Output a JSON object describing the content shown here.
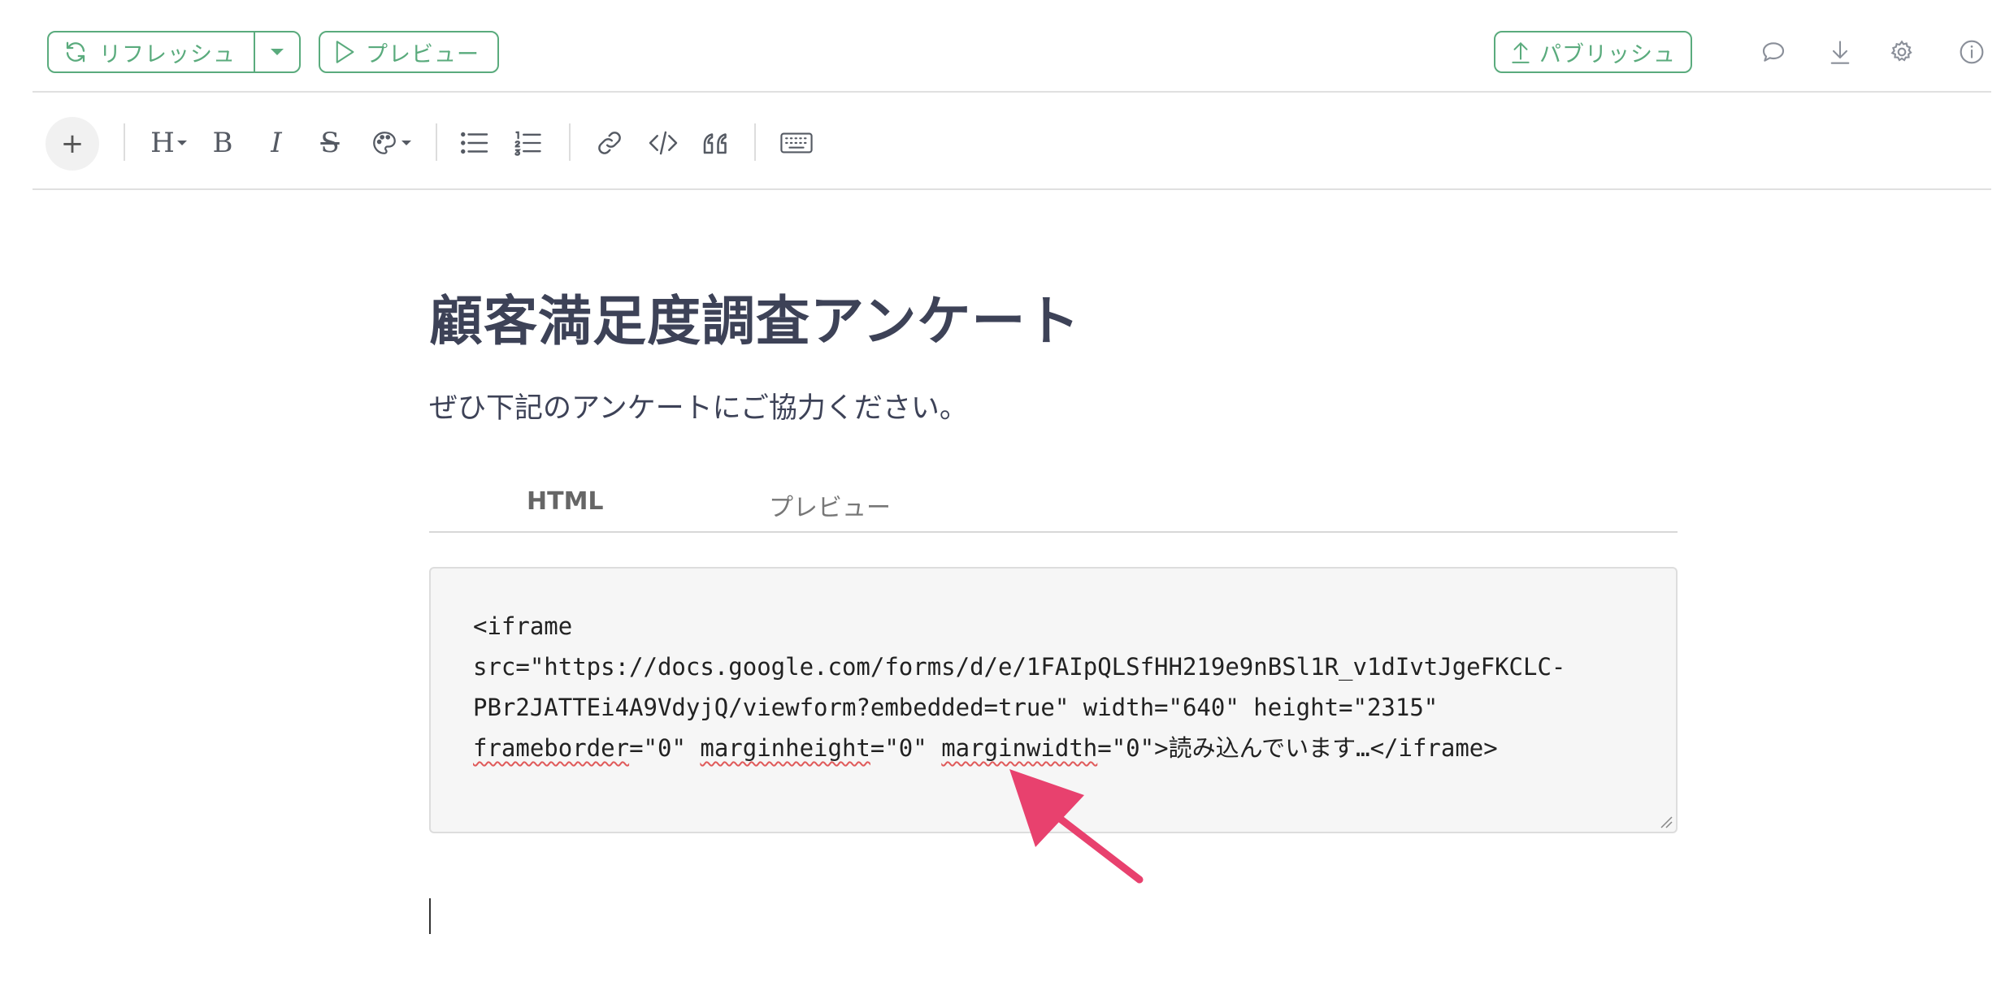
{
  "topbar": {
    "refresh_label": "リフレッシュ",
    "preview_label": "プレビュー",
    "publish_label": "パブリッシュ",
    "icons": [
      "comment-icon",
      "download-icon",
      "gear-icon",
      "info-icon"
    ]
  },
  "toolbar": {
    "insert_label": "+",
    "heading_label": "H",
    "bold_label": "B",
    "italic_label": "I",
    "strike_label": "S",
    "icons": [
      "palette-icon",
      "bullet-list-icon",
      "numbered-list-icon",
      "link-icon",
      "code-icon",
      "quote-icon",
      "keyboard-icon"
    ]
  },
  "document": {
    "title": "顧客満足度調査アンケート",
    "intro": "ぜひ下記のアンケートにご協力ください。",
    "tabs": [
      {
        "label": "HTML",
        "active": true
      },
      {
        "label": "プレビュー",
        "active": false
      }
    ],
    "code": {
      "line1": "<iframe",
      "line2": "src=\"https://docs.google.com/forms/d/e/1FAIpQLSfHH219e9nBSl1R_v1dIvtJgeFKCLC-",
      "line3": "PBr2JATTEi4A9VdyjQ/viewform?embedded=true\" width=\"640\" height=\"2315\"",
      "line4_a": "frameborder",
      "line4_b": "=\"0\" ",
      "line4_c": "marginheight",
      "line4_d": "=\"0\" ",
      "line4_e": "marginwidth",
      "line4_f": "=\"0\">読み込んでいます…</iframe>"
    }
  },
  "colors": {
    "accent": "#5aab7d",
    "annotation_arrow": "#e8416e",
    "text": "#3d4257"
  }
}
